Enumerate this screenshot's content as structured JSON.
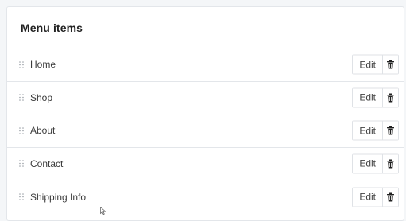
{
  "card": {
    "title": "Menu items"
  },
  "menu": {
    "items": [
      {
        "label": "Home",
        "edit_label": "Edit",
        "delete_icon": "trash-icon"
      },
      {
        "label": "Shop",
        "edit_label": "Edit",
        "delete_icon": "trash-icon"
      },
      {
        "label": "About",
        "edit_label": "Edit",
        "delete_icon": "trash-icon"
      },
      {
        "label": "Contact",
        "edit_label": "Edit",
        "delete_icon": "trash-icon"
      },
      {
        "label": "Shipping Info",
        "edit_label": "Edit",
        "delete_icon": "trash-icon"
      }
    ]
  },
  "icons": {
    "drag_handle": "drag-handle-icon",
    "delete": "trash-icon",
    "cursor": "mouse-pointer-icon"
  },
  "colors": {
    "background": "#f4f6f8",
    "card": "#ffffff",
    "border": "#e3e6ea",
    "text": "#3a3a3a"
  }
}
